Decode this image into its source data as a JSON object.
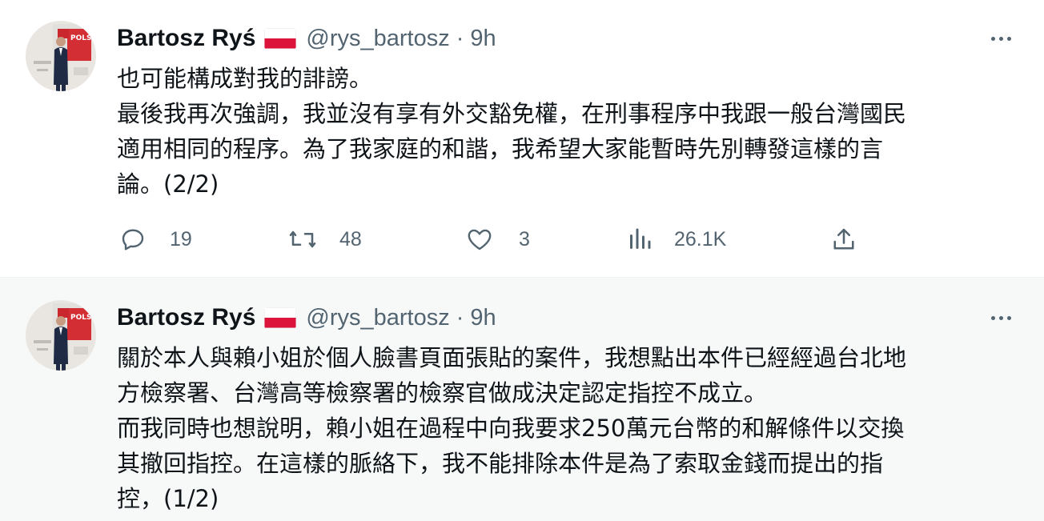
{
  "tweets": [
    {
      "author": {
        "name": "Bartosz Ryś",
        "handle": "@rys_bartosz",
        "separator": "·",
        "time": "9h",
        "flag_icon": "poland-flag-icon"
      },
      "text_lines": [
        "也可能構成對我的誹謗。",
        "最後我再次強調，我並沒有享有外交豁免權，在刑事程序中我跟一般台灣國民",
        "適用相同的程序。為了我家庭的和諧，我希望大家能暫時先別轉發這樣的言",
        "論。(2/2)"
      ],
      "stats": {
        "replies": "19",
        "retweets": "48",
        "likes": "3",
        "views": "26.1K"
      }
    },
    {
      "author": {
        "name": "Bartosz Ryś",
        "handle": "@rys_bartosz",
        "separator": "·",
        "time": "9h",
        "flag_icon": "poland-flag-icon"
      },
      "text_lines": [
        "關於本人與賴小姐於個人臉書頁面張貼的案件，我想點出本件已經經過台北地",
        "方檢察署、台灣高等檢察署的檢察官做成決定認定指控不成立。",
        "而我同時也想說明，賴小姐在過程中向我要求250萬元台幣的和解條件以交換",
        "其撤回指控。在這樣的脈絡下，我不能排除本件是為了索取金錢而提出的指",
        "控，(1/2)"
      ]
    }
  ],
  "colors": {
    "text": "#0f1419",
    "secondary": "#536471",
    "hover_bg": "#f7f9f9",
    "flag_red": "#dc143c"
  },
  "icons": [
    "reply-icon",
    "retweet-icon",
    "like-icon",
    "views-icon",
    "share-icon",
    "more-icon"
  ]
}
